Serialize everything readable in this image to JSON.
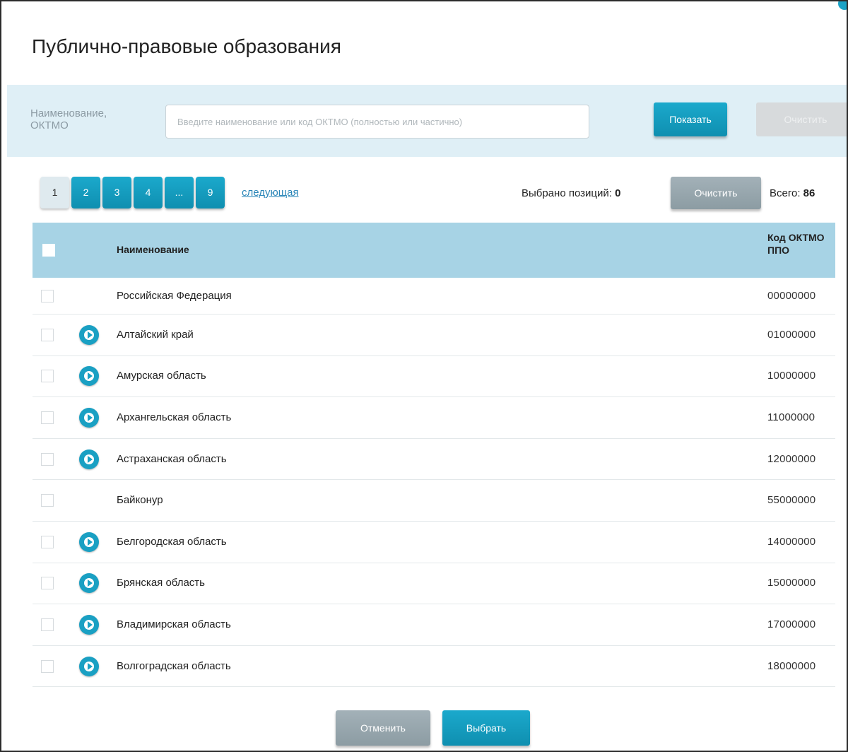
{
  "title": "Публично-правовые образования",
  "search": {
    "label": "Наименование, ОКТМО",
    "placeholder": "Введите наименование или код ОКТМО (полностью или частично)",
    "value": "",
    "show_button": "Показать",
    "clear_button": "Очистить"
  },
  "pagination": {
    "pages": [
      "1",
      "2",
      "3",
      "4",
      "...",
      "9"
    ],
    "active_page": "1",
    "next_label": "следующая"
  },
  "selection": {
    "selected_label": "Выбрано позиций:",
    "selected_count": "0",
    "clear_button": "Очистить",
    "total_label": "Всего:",
    "total_count": "86"
  },
  "table": {
    "headers": {
      "name": "Наименование",
      "code": "Код ОКТМО ППО"
    },
    "rows": [
      {
        "name": "Российская Федерация",
        "code": "00000000",
        "expandable": false
      },
      {
        "name": "Алтайский край",
        "code": "01000000",
        "expandable": true
      },
      {
        "name": "Амурская область",
        "code": "10000000",
        "expandable": true
      },
      {
        "name": "Архангельская область",
        "code": "11000000",
        "expandable": true
      },
      {
        "name": "Астраханская область",
        "code": "12000000",
        "expandable": true
      },
      {
        "name": "Байконур",
        "code": "55000000",
        "expandable": false
      },
      {
        "name": "Белгородская область",
        "code": "14000000",
        "expandable": true
      },
      {
        "name": "Брянская область",
        "code": "15000000",
        "expandable": true
      },
      {
        "name": "Владимирская область",
        "code": "17000000",
        "expandable": true
      },
      {
        "name": "Волгоградская область",
        "code": "18000000",
        "expandable": true
      }
    ]
  },
  "footer": {
    "cancel_button": "Отменить",
    "select_button": "Выбрать"
  },
  "colors": {
    "accent": "#1ba9cc",
    "header_bg": "#a7d3e5",
    "search_bg": "#dfeff6",
    "link": "#2a86b8"
  }
}
